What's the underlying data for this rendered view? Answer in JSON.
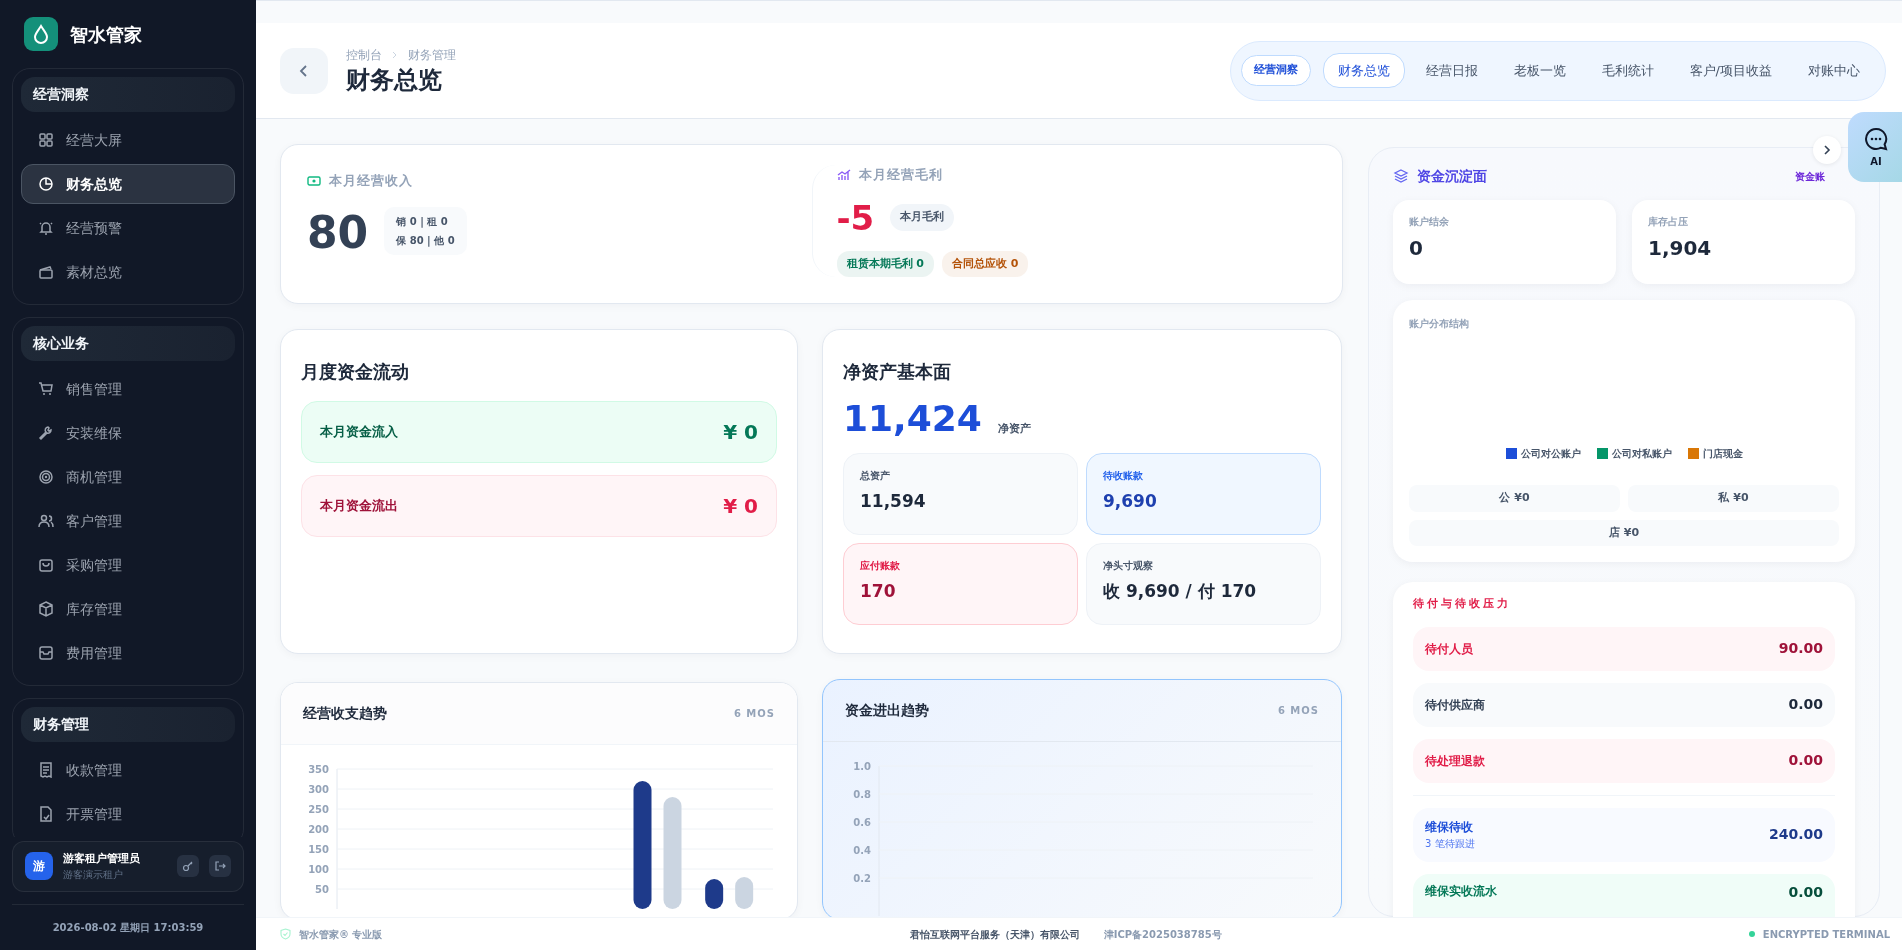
{
  "sidebar": {
    "brand": "智水管家",
    "groups": [
      {
        "title": "经营洞察",
        "items": [
          {
            "label": "经营大屏",
            "selected": false
          },
          {
            "label": "财务总览",
            "selected": true
          },
          {
            "label": "经营预警",
            "selected": false
          },
          {
            "label": "素材总览",
            "selected": false
          }
        ]
      },
      {
        "title": "核心业务",
        "items": [
          {
            "label": "销售管理",
            "selected": false
          },
          {
            "label": "安装维保",
            "selected": false
          },
          {
            "label": "商机管理",
            "selected": false
          },
          {
            "label": "客户管理",
            "selected": false
          },
          {
            "label": "采购管理",
            "selected": false
          },
          {
            "label": "库存管理",
            "selected": false
          },
          {
            "label": "费用管理",
            "selected": false
          }
        ]
      },
      {
        "title": "财务管理",
        "items": [
          {
            "label": "收款管理",
            "selected": false
          },
          {
            "label": "开票管理",
            "selected": false
          }
        ]
      }
    ],
    "user": {
      "avatar": "游",
      "name": "游客租户管理员",
      "role": "游客演示租户"
    },
    "datetime": "2026-08-02 星期日 17:03:59"
  },
  "header": {
    "breadcrumb": [
      "控制台",
      "财务管理"
    ],
    "title": "财务总览",
    "section_label": "经营洞察",
    "tabs": [
      {
        "label": "财务总览",
        "selected": true
      },
      {
        "label": "经营日报",
        "selected": false
      },
      {
        "label": "老板一览",
        "selected": false
      },
      {
        "label": "毛利统计",
        "selected": false
      },
      {
        "label": "客户/项目收益",
        "selected": false
      },
      {
        "label": "对账中心",
        "selected": false
      }
    ]
  },
  "revenue": {
    "label": "本月经营收入",
    "value": "80",
    "breakdown": [
      "销 0 | 租 0",
      "保 80 | 他 0"
    ]
  },
  "margin": {
    "label": "本月经营毛利",
    "value": "-5",
    "badge": "本月毛利",
    "tags": [
      {
        "text": "租赁本期毛利 0",
        "color": "#047857"
      },
      {
        "text": "合同总应收 0",
        "color": "#b45309"
      }
    ]
  },
  "cash_flow": {
    "title": "月度资金流动",
    "rows": [
      {
        "kind": "in",
        "label": "本月资金流入",
        "value": "¥ 0"
      },
      {
        "kind": "out",
        "label": "本月资金流出",
        "value": "¥ 0"
      }
    ]
  },
  "net_assets": {
    "title": "净资产基本面",
    "value": "11,424",
    "unit": "净资产",
    "tiles": [
      {
        "kind": "neutral",
        "label": "总资产",
        "value": "11,594"
      },
      {
        "kind": "receivable",
        "label": "待收账款",
        "value": "9,690"
      },
      {
        "kind": "payable",
        "label": "应付账款",
        "value": "170"
      },
      {
        "kind": "neutral",
        "label": "净头寸观察",
        "value": "收 9,690 / 付 170"
      }
    ]
  },
  "trend_chart": {
    "title": "经营收支趋势",
    "badge": "6 MOS",
    "chart_data": {
      "type": "bar",
      "grid": true,
      "ylim": [
        0,
        350
      ],
      "yticks": [
        50,
        100,
        150,
        200,
        250,
        300,
        350
      ],
      "series": [
        {
          "color": "#1e3a8a",
          "values": [
            0,
            0,
            0,
            0,
            320,
            75
          ]
        },
        {
          "color": "#cbd5e1",
          "values": [
            0,
            0,
            0,
            0,
            280,
            80
          ]
        }
      ]
    }
  },
  "flow_chart": {
    "title": "资金进出趋势",
    "badge": "6 MOS",
    "axis_labels": [
      "1.0",
      "0.8",
      "0.6",
      "0.4",
      "0.2"
    ]
  },
  "funds": {
    "title": "资金沉淀面",
    "link": "资金账",
    "stats": [
      {
        "label": "账户结余",
        "value": "0"
      },
      {
        "label": "库存占压",
        "value": "1,904"
      }
    ],
    "distribution": {
      "title": "账户分布结构",
      "legend": [
        {
          "label": "公司对公账户",
          "color": "#1d4ed8"
        },
        {
          "label": "公司对私账户",
          "color": "#059669"
        },
        {
          "label": "门店现金",
          "color": "#d97706"
        }
      ],
      "chips": [
        "公 ¥0",
        "私 ¥0",
        "店 ¥0"
      ]
    }
  },
  "pressure": {
    "title": "待付与待收压力",
    "rows": [
      {
        "kind": "payable",
        "label": "待付人员",
        "value": "90.00"
      },
      {
        "kind": "neutral",
        "label": "待付供应商",
        "value": "0.00"
      },
      {
        "kind": "payable",
        "label": "待处理退款",
        "value": "0.00"
      },
      {
        "kind": "receivable",
        "label": "维保待收",
        "sub": "3 笔待跟进",
        "value": "240.00"
      },
      {
        "kind": "received",
        "label": "维保实收流水",
        "value": "0.00"
      }
    ]
  },
  "ai_button": {
    "label": "AI"
  },
  "footer": {
    "edition": "智水管家® 专业版",
    "company": "君怡互联网平台服务（天津）有限公司",
    "icp": "津ICP备2025038785号",
    "status": "ENCRYPTED TERMINAL"
  }
}
